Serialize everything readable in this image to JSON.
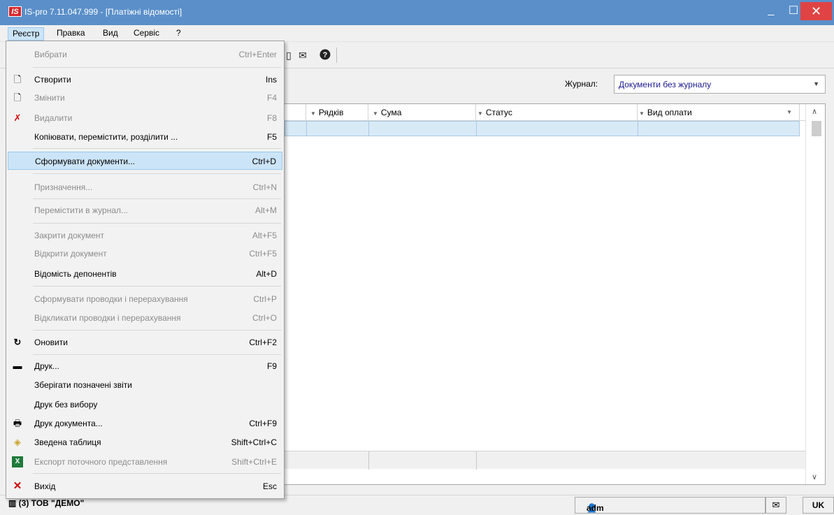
{
  "window": {
    "logo": "IS",
    "title": "IS-pro 7.11.047.999 - [Платіжні відомості]",
    "min_glyph": "_",
    "max_glyph": "☐",
    "close_glyph": "✕"
  },
  "menubar": {
    "items": [
      "Реєстр",
      "Правка",
      "Вид",
      "Сервіс",
      "?"
    ]
  },
  "toolbar": {
    "icons": [
      "document-icon",
      "mail-icon",
      "help-icon"
    ]
  },
  "journal": {
    "label": "Журнал:",
    "value": "Документи без журналу"
  },
  "grid": {
    "columns": [
      "Рядків",
      "Сума",
      "Статус",
      "Вид оплати"
    ]
  },
  "statusbar": {
    "company": "(3) ТОВ \"ДЕМО\"",
    "user": "adm",
    "lang": "UK"
  },
  "menu": {
    "items": [
      {
        "label": "Вибрати",
        "shortcut": "Ctrl+Enter",
        "disabled": true,
        "icon": ""
      },
      {
        "label": "Створити",
        "shortcut": "Ins",
        "disabled": false,
        "icon": "new-document-icon"
      },
      {
        "label": "Змінити",
        "shortcut": "F4",
        "disabled": true,
        "icon": "edit-document-icon"
      },
      {
        "label": "Видалити",
        "shortcut": "F8",
        "disabled": true,
        "icon": "delete-document-icon"
      },
      {
        "label": "Копіювати, перемістити, розділити ...",
        "shortcut": "F5",
        "disabled": false,
        "icon": ""
      },
      {
        "label": "Сформувати документи...",
        "shortcut": "Ctrl+D",
        "disabled": false,
        "icon": ""
      },
      {
        "label": "Призначення...",
        "shortcut": "Ctrl+N",
        "disabled": true,
        "icon": ""
      },
      {
        "label": "Перемістити в журнал...",
        "shortcut": "Alt+M",
        "disabled": true,
        "icon": ""
      },
      {
        "label": "Закрити документ",
        "shortcut": "Alt+F5",
        "disabled": true,
        "icon": ""
      },
      {
        "label": "Відкрити документ",
        "shortcut": "Ctrl+F5",
        "disabled": true,
        "icon": ""
      },
      {
        "label": "Відомість депонентів",
        "shortcut": "Alt+D",
        "disabled": false,
        "icon": ""
      },
      {
        "label": "Сформувати проводки і перерахування",
        "shortcut": "Ctrl+P",
        "disabled": true,
        "icon": ""
      },
      {
        "label": "Відкликати проводки і перерахування",
        "shortcut": "Ctrl+O",
        "disabled": true,
        "icon": ""
      },
      {
        "label": "Оновити",
        "shortcut": "Ctrl+F2",
        "disabled": false,
        "icon": "refresh-icon"
      },
      {
        "label": "Друк...",
        "shortcut": "F9",
        "disabled": false,
        "icon": "printer-icon"
      },
      {
        "label": "Зберігати позначені звіти",
        "shortcut": "",
        "disabled": false,
        "icon": ""
      },
      {
        "label": "Друк без вибору",
        "shortcut": "",
        "disabled": false,
        "icon": ""
      },
      {
        "label": "Друк документа...",
        "shortcut": "Ctrl+F9",
        "disabled": false,
        "icon": "print-document-icon"
      },
      {
        "label": "Зведена таблиця",
        "shortcut": "Shift+Ctrl+C",
        "disabled": false,
        "icon": "pivot-table-icon"
      },
      {
        "label": "Експорт поточного представлення",
        "shortcut": "Shift+Ctrl+E",
        "disabled": true,
        "icon": "excel-export-icon"
      },
      {
        "label": "Вихід",
        "shortcut": "Esc",
        "disabled": false,
        "icon": "exit-icon"
      }
    ]
  }
}
